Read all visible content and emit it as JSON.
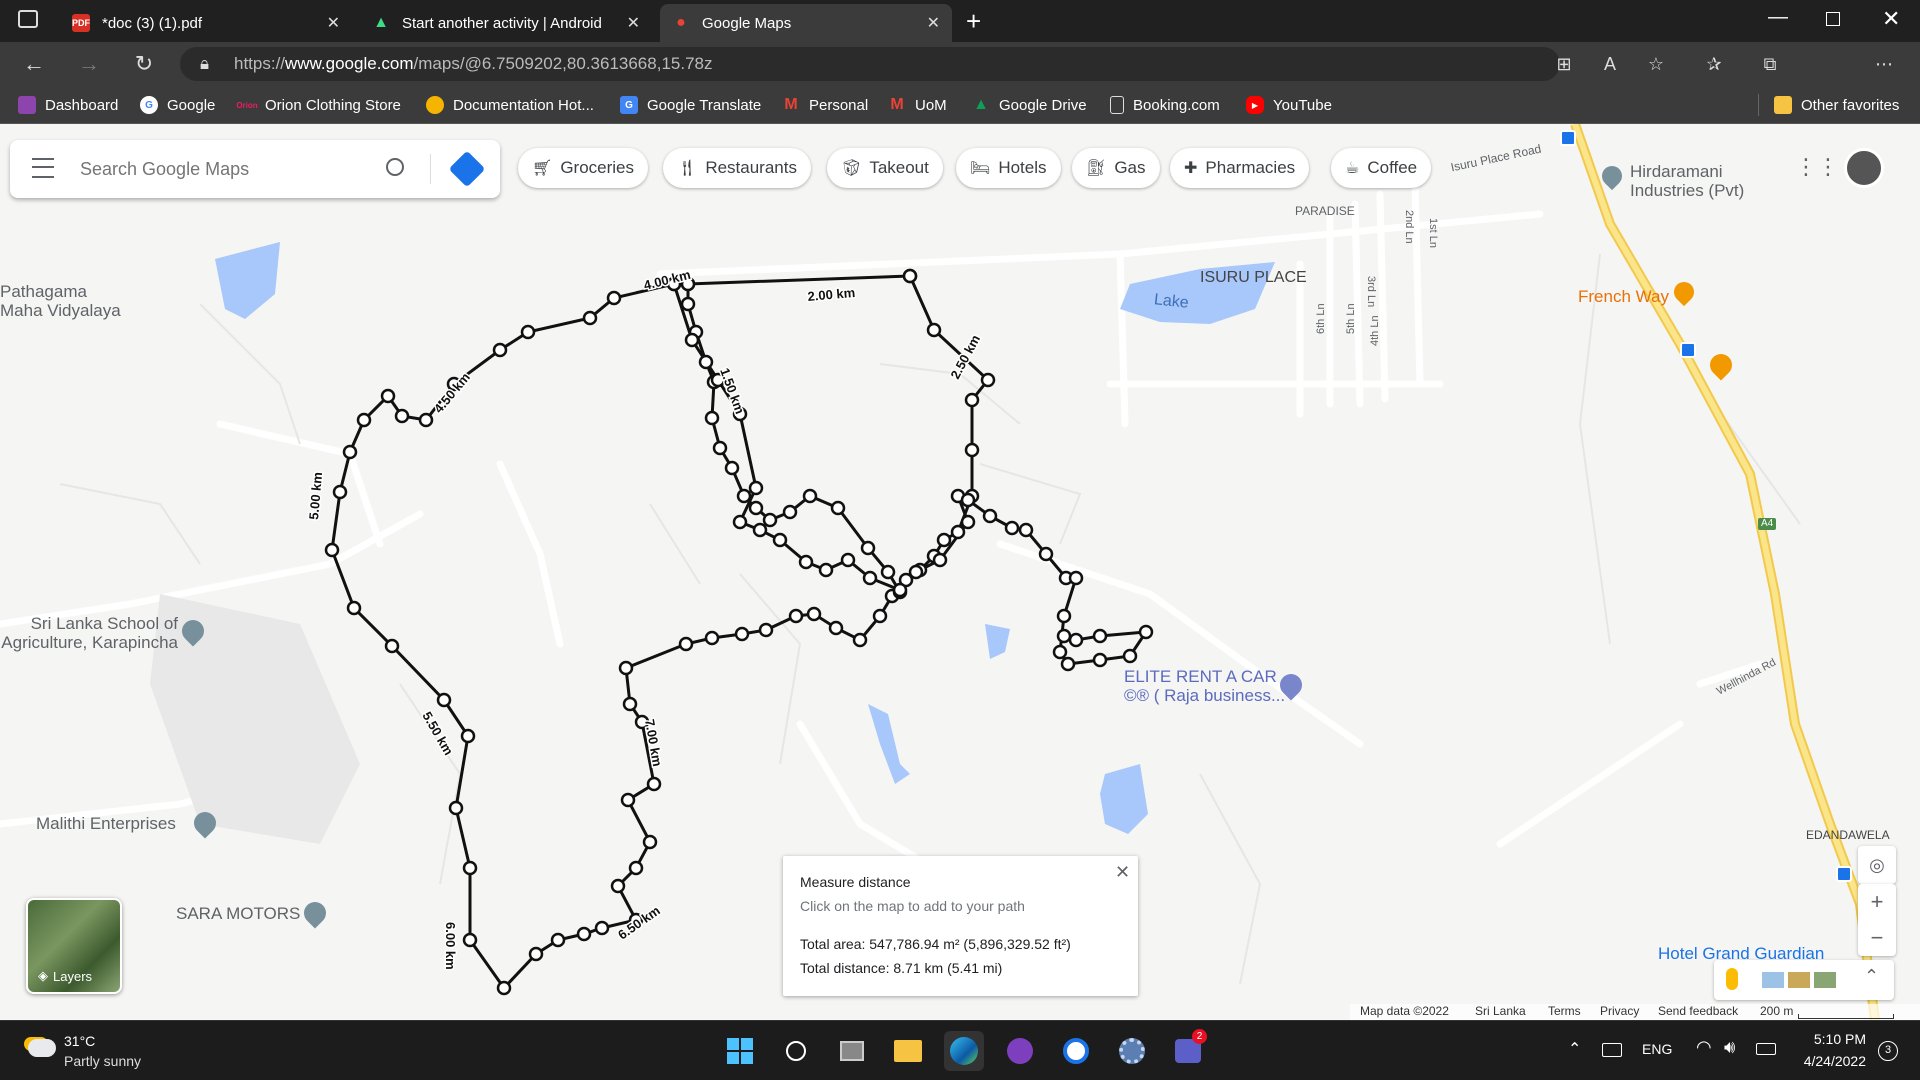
{
  "tabs": [
    {
      "title": "*doc (3) (1).pdf",
      "icon": "pdf-icon"
    },
    {
      "title": "Start another activity  |  Android",
      "icon": "android-icon"
    },
    {
      "title": "Google Maps",
      "icon": "maps-pin-icon"
    }
  ],
  "address": {
    "prefix": "https://",
    "host": "www.google.com",
    "path": "/maps/@6.7509202,80.3613668,15.78z"
  },
  "bookmarks": [
    "Dashboard",
    "Google",
    "Orion Clothing Store",
    "Documentation Hot...",
    "Google Translate",
    "Personal",
    "UoM",
    "Google Drive",
    "Booking.com",
    "YouTube"
  ],
  "other_favorites": "Other favorites",
  "search": {
    "placeholder": "Search Google Maps"
  },
  "chips": [
    {
      "label": "Groceries",
      "icon": "cart-icon"
    },
    {
      "label": "Restaurants",
      "icon": "cutlery-icon"
    },
    {
      "label": "Takeout",
      "icon": "takeout-icon"
    },
    {
      "label": "Hotels",
      "icon": "bed-icon"
    },
    {
      "label": "Gas",
      "icon": "gas-icon"
    },
    {
      "label": "Pharmacies",
      "icon": "pharmacy-icon"
    },
    {
      "label": "Coffee",
      "icon": "coffee-icon"
    }
  ],
  "map_labels": {
    "pathagama": [
      "Pathagama",
      "Maha Vidyalaya"
    ],
    "isuru_road": "Isuru Place Road",
    "hirdaramani": [
      "Hirdaramani",
      "Industries (Pvt)"
    ],
    "paradise": "PARADISE",
    "isuru_place": "ISURU PLACE",
    "lake": "Lake",
    "french_way": "French Way",
    "school": [
      "Sri Lanka School of",
      "Agriculture, Karapincha"
    ],
    "elite": [
      "ELITE RENT A CAR",
      "©® ( Raja business..."
    ],
    "malithi": "Malithi Enterprises",
    "sara": "SARA MOTORS",
    "edandawela": "EDANDAWELA",
    "hotel": "Hotel Grand Guardian",
    "wellhinda": "Wellhinda Rd",
    "a4": "A4",
    "lanes": [
      "6th Ln",
      "5th Ln",
      "4th Ln",
      "3rd Ln",
      "2nd Ln",
      "1st Ln"
    ]
  },
  "distance_labels": [
    "4.00 km",
    "2.00 km",
    "1.50 km",
    "2.50 km",
    "4.50 km",
    "5.00 km",
    "5.50 km",
    "7.00 km",
    "6.00 km",
    "6.50 km"
  ],
  "measure": {
    "title": "Measure distance",
    "hint": "Click on the map to add to your path",
    "area": "Total area: 547,786.94 m² (5,896,329.52 ft²)",
    "distance": "Total distance: 8.71 km (5.41 mi)"
  },
  "layers_label": "Layers",
  "footer": [
    "Map data ©2022",
    "Sri Lanka",
    "Terms",
    "Privacy",
    "Send feedback",
    "200 m"
  ],
  "weather": {
    "temp": "31°C",
    "desc": "Partly sunny"
  },
  "tray": {
    "lang": "ENG",
    "time": "5:10 PM",
    "date": "4/24/2022",
    "notifications": "3",
    "teams_badge": "2"
  },
  "colors": {
    "road_major": "#f9d65b",
    "water": "#a8c7fa",
    "route": "#000000",
    "map_bg": "#f5f5f3"
  }
}
